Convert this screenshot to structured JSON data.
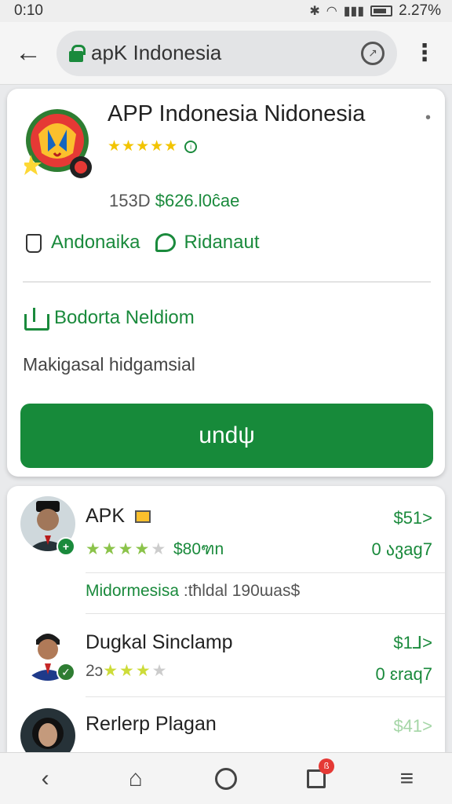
{
  "status_bar": {
    "time": "0:10",
    "battery": "2.27%"
  },
  "browser": {
    "url": "apK Indonesia"
  },
  "app": {
    "title": "APP Indonesia Nidonesia",
    "stars": "★★★★★",
    "meta_count": "153D",
    "meta_price": "$626.l0ĉae",
    "actions": [
      "Andonaika",
      "Ridanaut"
    ],
    "share_label": "Bodorta Neldiom",
    "description": "Makigasal hidgamsial",
    "download_label": "undψ"
  },
  "list": [
    {
      "title": "APK",
      "stars_full": "★★★★",
      "stars_dim": "★",
      "sub": "$80ฑn",
      "price": "$51>",
      "meta": "0 ავag7"
    },
    {
      "category": "Midormesisa",
      "category_meta": ":tħldal 190ɯas$"
    },
    {
      "title": "Dugkal Sinclamp",
      "stars_prefix": "2ɔ",
      "stars_full": "★★★",
      "stars_dim": "★",
      "price": "$1⅃>",
      "meta": "0 ɛraq7"
    },
    {
      "title": "Rerlerp Plagan",
      "price": "$41>"
    }
  ],
  "colors": {
    "accent": "#178a3a",
    "star": "#f2c400",
    "badge": "#e53935"
  },
  "icons": [
    "back-arrow-icon",
    "lock-icon",
    "tab-switch-icon",
    "overflow-menu-icon",
    "info-icon",
    "hand-icon",
    "chat-bubble-icon",
    "share-icon",
    "home-icon",
    "tabs-icon"
  ]
}
